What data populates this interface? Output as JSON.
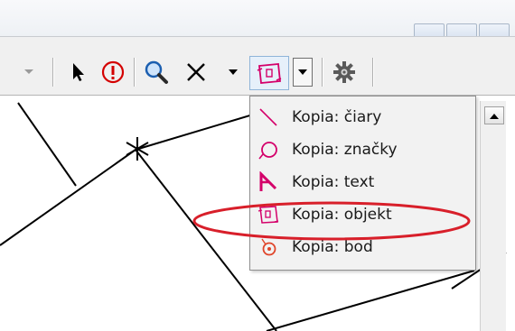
{
  "toolbar": {
    "tools": [
      {
        "name": "select-arrow-icon",
        "color": "#000000"
      },
      {
        "name": "info-icon",
        "color": "#d40000"
      },
      {
        "name": "magnifier-icon",
        "color": "#1c5fb0"
      },
      {
        "name": "delete-cross-icon",
        "color": "#000000"
      },
      {
        "name": "copy-object-icon",
        "color": "#d4006a"
      },
      {
        "name": "gear-icon",
        "color": "#404040"
      }
    ]
  },
  "copy_menu": {
    "items": [
      {
        "label": "Kopia: čiary",
        "icon": "line-icon",
        "color": "#d4006a"
      },
      {
        "label": "Kopia: značky",
        "icon": "symbol-icon",
        "color": "#d4006a"
      },
      {
        "label": "Kopia: text",
        "icon": "text-icon",
        "color": "#d4006a"
      },
      {
        "label": "Kopia: objekt",
        "icon": "object-icon",
        "color": "#d4006a",
        "highlighted": true
      },
      {
        "label": "Kopia: bod",
        "icon": "point-icon",
        "color": "#e0452a"
      }
    ]
  },
  "highlight_color": "#d81f2a"
}
